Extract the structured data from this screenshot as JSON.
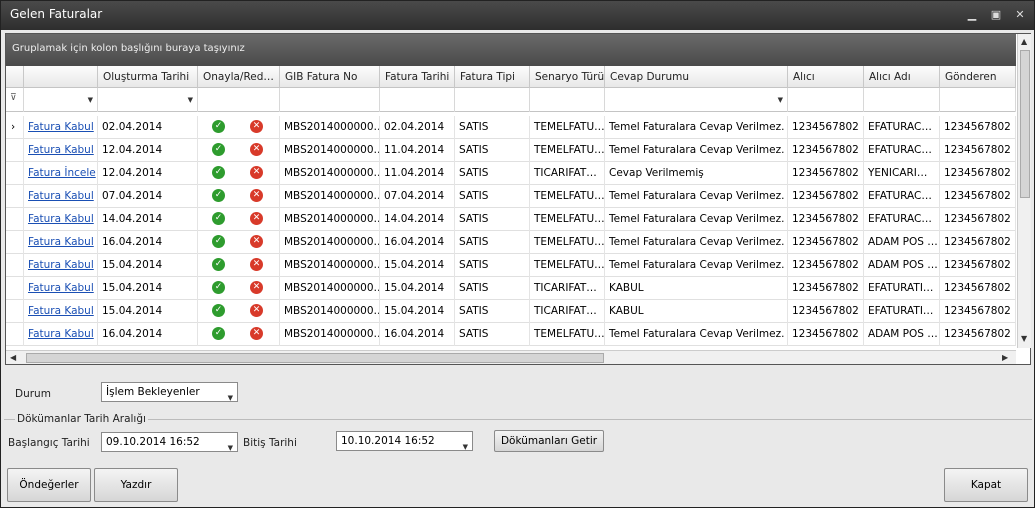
{
  "window": {
    "title": "Gelen Faturalar"
  },
  "grid": {
    "group_hint": "Gruplamak için kolon başlığını buraya taşıyınız",
    "columns": [
      "",
      "Oluşturma Tarihi",
      "Onayla/Red…",
      "GIB Fatura No",
      "Fatura Tarihi",
      "Fatura Tipi",
      "Senaryo Türü",
      "Cevap Durumu",
      "Alıcı",
      "Alıcı Adı",
      "Gönderen"
    ],
    "rows": [
      {
        "action": "Fatura Kabul",
        "created": "02.04.2014",
        "gib": "MBS2014000000…",
        "date": "02.04.2014",
        "type": "SATIS",
        "scenario": "TEMELFATU…",
        "response": "Temel Faturalara Cevap Verilmez.",
        "receiver": "1234567802",
        "receiver_name": "EFATURAC…",
        "sender": "1234567802"
      },
      {
        "action": "Fatura Kabul",
        "created": "12.04.2014",
        "gib": "MBS2014000000…",
        "date": "11.04.2014",
        "type": "SATIS",
        "scenario": "TEMELFATU…",
        "response": "Temel Faturalara Cevap Verilmez.",
        "receiver": "1234567802",
        "receiver_name": "EFATURAC…",
        "sender": "1234567802"
      },
      {
        "action": "Fatura İncele",
        "created": "12.04.2014",
        "gib": "MBS2014000000…",
        "date": "11.04.2014",
        "type": "SATIS",
        "scenario": "TICARIFAT…",
        "response": "Cevap Verilmemiş",
        "receiver": "1234567802",
        "receiver_name": "YENICARI…",
        "sender": "1234567802"
      },
      {
        "action": "Fatura Kabul",
        "created": "07.04.2014",
        "gib": "MBS2014000000…",
        "date": "07.04.2014",
        "type": "SATIS",
        "scenario": "TEMELFATU…",
        "response": "Temel Faturalara Cevap Verilmez.",
        "receiver": "1234567802",
        "receiver_name": "EFATURAC…",
        "sender": "1234567802"
      },
      {
        "action": "Fatura Kabul",
        "created": "14.04.2014",
        "gib": "MBS2014000000…",
        "date": "14.04.2014",
        "type": "SATIS",
        "scenario": "TEMELFATU…",
        "response": "Temel Faturalara Cevap Verilmez.",
        "receiver": "1234567802",
        "receiver_name": "EFATURAC…",
        "sender": "1234567802"
      },
      {
        "action": "Fatura Kabul",
        "created": "16.04.2014",
        "gib": "MBS2014000000…",
        "date": "16.04.2014",
        "type": "SATIS",
        "scenario": "TEMELFATU…",
        "response": "Temel Faturalara Cevap Verilmez.",
        "receiver": "1234567802",
        "receiver_name": "ADAM POS …",
        "sender": "1234567802"
      },
      {
        "action": "Fatura Kabul",
        "created": "15.04.2014",
        "gib": "MBS2014000000…",
        "date": "15.04.2014",
        "type": "SATIS",
        "scenario": "TEMELFATU…",
        "response": "Temel Faturalara Cevap Verilmez.",
        "receiver": "1234567802",
        "receiver_name": "ADAM POS …",
        "sender": "1234567802"
      },
      {
        "action": "Fatura Kabul",
        "created": "15.04.2014",
        "gib": "MBS2014000000…",
        "date": "15.04.2014",
        "type": "SATIS",
        "scenario": "TICARIFAT…",
        "response": "KABUL",
        "receiver": "1234567802",
        "receiver_name": "EFATURATI…",
        "sender": "1234567802"
      },
      {
        "action": "Fatura Kabul",
        "created": "15.04.2014",
        "gib": "MBS2014000000…",
        "date": "15.04.2014",
        "type": "SATIS",
        "scenario": "TICARIFAT…",
        "response": "KABUL",
        "receiver": "1234567802",
        "receiver_name": "EFATURATI…",
        "sender": "1234567802"
      },
      {
        "action": "Fatura Kabul",
        "created": "16.04.2014",
        "gib": "MBS2014000000…",
        "date": "16.04.2014",
        "type": "SATIS",
        "scenario": "TEMELFATU…",
        "response": "Temel Faturalara Cevap Verilmez.",
        "receiver": "1234567802",
        "receiver_name": "ADAM POS …",
        "sender": "1234567802"
      }
    ]
  },
  "filters": {
    "status_label": "Durum",
    "status_value": "İşlem Bekleyenler",
    "range_group": "Dökümanlar Tarih Aralığı",
    "start_label": "Başlangıç Tarihi",
    "start_value": "09.10.2014 16:52",
    "end_label": "Bitiş Tarihi",
    "end_value": "10.10.2014 16:52",
    "fetch_button": "Dökümanları Getir"
  },
  "footer": {
    "defaults_button": "Öndeğerler",
    "print_button": "Yazdır",
    "close_button": "Kapat"
  }
}
